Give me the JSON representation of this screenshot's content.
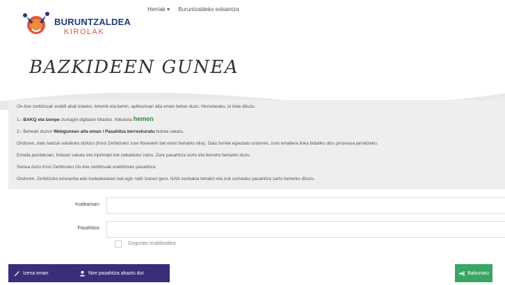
{
  "header": {
    "logo_top": "BURUNTZALDEA",
    "logo_sub": "KIROLAK",
    "nav": [
      "Herriak ▾",
      "Buruntzaldeko eskaintza"
    ]
  },
  "page_title": "BAZKIDEEN GUNEA",
  "info": {
    "line1": "On-line zerbitzuak erabili ahal izateko, lehenik eta behin, aplikazioan alta eman behar duzu. Horretarako, bi bide dituzu:",
    "line2_num": "1.- ",
    "line2_bold": "BAKQ eta Izenpe",
    "line2_rest": " ziurtagiri digitalen bitartez. Klikatuta ",
    "line2_link": "hemen",
    "line3_num": "2.- Behean duzun ",
    "line3_bold": "Webgunean alta eman / Pasahitza berreskuratu",
    "line3_rest": " botoia sakatu.",
    "line4": "Ondoren, datu batzuk eskatuko dizkizu (Kirol Zerbitzuko zure fitxarekin bat etorri beharko dira). Datu horiek egiaztatu ondoren, zure emailera linka bidaliko dizu prozesua jarraitzeko.",
    "line5": "Emaila jasotakoan, linkean sakatu eta inprimaki bat zabalduko zaizu. Zure pasahitza sortu eta berretsi beharko duzu.",
    "line6": "Sortua duzu Kirol Zerbitzuko On-line zerbitzuak erabiltzeko pasahitza.",
    "line7": "Ondoren, Zerbitzuko erreserba edo kudeaketaren bat egin nahi izanez gero, NAN zenbakia letrakin eta zuk sortutako pasahitza sartu beharko dituzu."
  },
  "form": {
    "code_label": "Kodea/nan:",
    "password_label": "Pasahitza:",
    "code_value": "",
    "password_value": "",
    "remember_label": "Gogoratu erabiltzailea"
  },
  "buttons": {
    "register": "Izena eman",
    "forgot": "Nire pasahitza ahaztu dut",
    "validate": "Balioztatu"
  },
  "colors": {
    "brand_purple": "#3a2d7a",
    "brand_green": "#3aa565",
    "link_green": "#2e8b3c",
    "logo_blue": "#1f3b7a",
    "logo_red": "#e0554a"
  }
}
